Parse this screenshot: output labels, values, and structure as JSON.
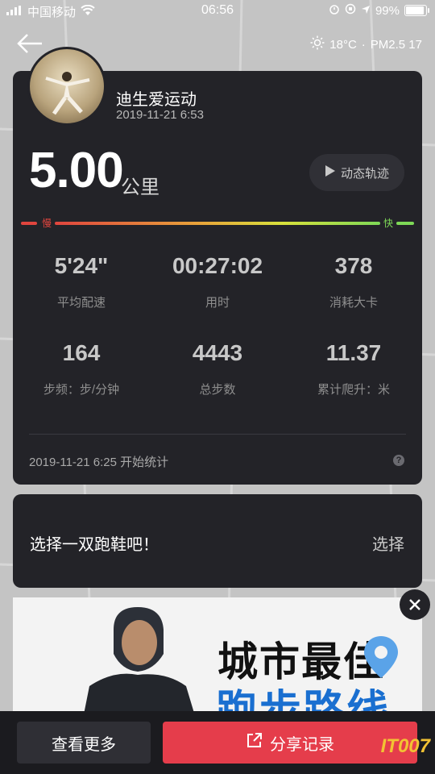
{
  "status_bar": {
    "carrier": "中国移动",
    "time": "06:56",
    "battery_percent": "99%",
    "battery_level": 0.99
  },
  "weather": {
    "temperature": "18°C",
    "separator": "·",
    "air_quality": "PM2.5 17"
  },
  "workout": {
    "user_name": "迪生爱运动",
    "date_time": "2019-11-21 6:53",
    "distance": "5.00",
    "distance_unit": "公里",
    "track_button": "动态轨迹",
    "pace_slow_label": "慢",
    "pace_fast_label": "快",
    "stats": [
      {
        "value": "5'24\"",
        "label": "平均配速"
      },
      {
        "value": "00:27:02",
        "label": "用时"
      },
      {
        "value": "378",
        "label": "消耗大卡"
      },
      {
        "value": "164",
        "label": "步频：步/分钟"
      },
      {
        "value": "4443",
        "label": "总步数"
      },
      {
        "value": "11.37",
        "label": "累计爬升：米"
      }
    ],
    "start_info": "2019-11-21 6:25 开始统计",
    "help_glyph": "?"
  },
  "shoes": {
    "prompt": "选择一双跑鞋吧！",
    "select_label": "选择"
  },
  "ad": {
    "line1": "城市最佳",
    "line2": "跑步路线"
  },
  "bottom_bar": {
    "more_label": "查看更多",
    "share_label": "分享记录"
  },
  "watermark": "IT007",
  "colors": {
    "card_bg": "#232328",
    "share_red": "#e53d4b",
    "pace_slow": "#e0453e",
    "pace_fast": "#7ed957",
    "ad_blue": "#1a6fd0"
  }
}
